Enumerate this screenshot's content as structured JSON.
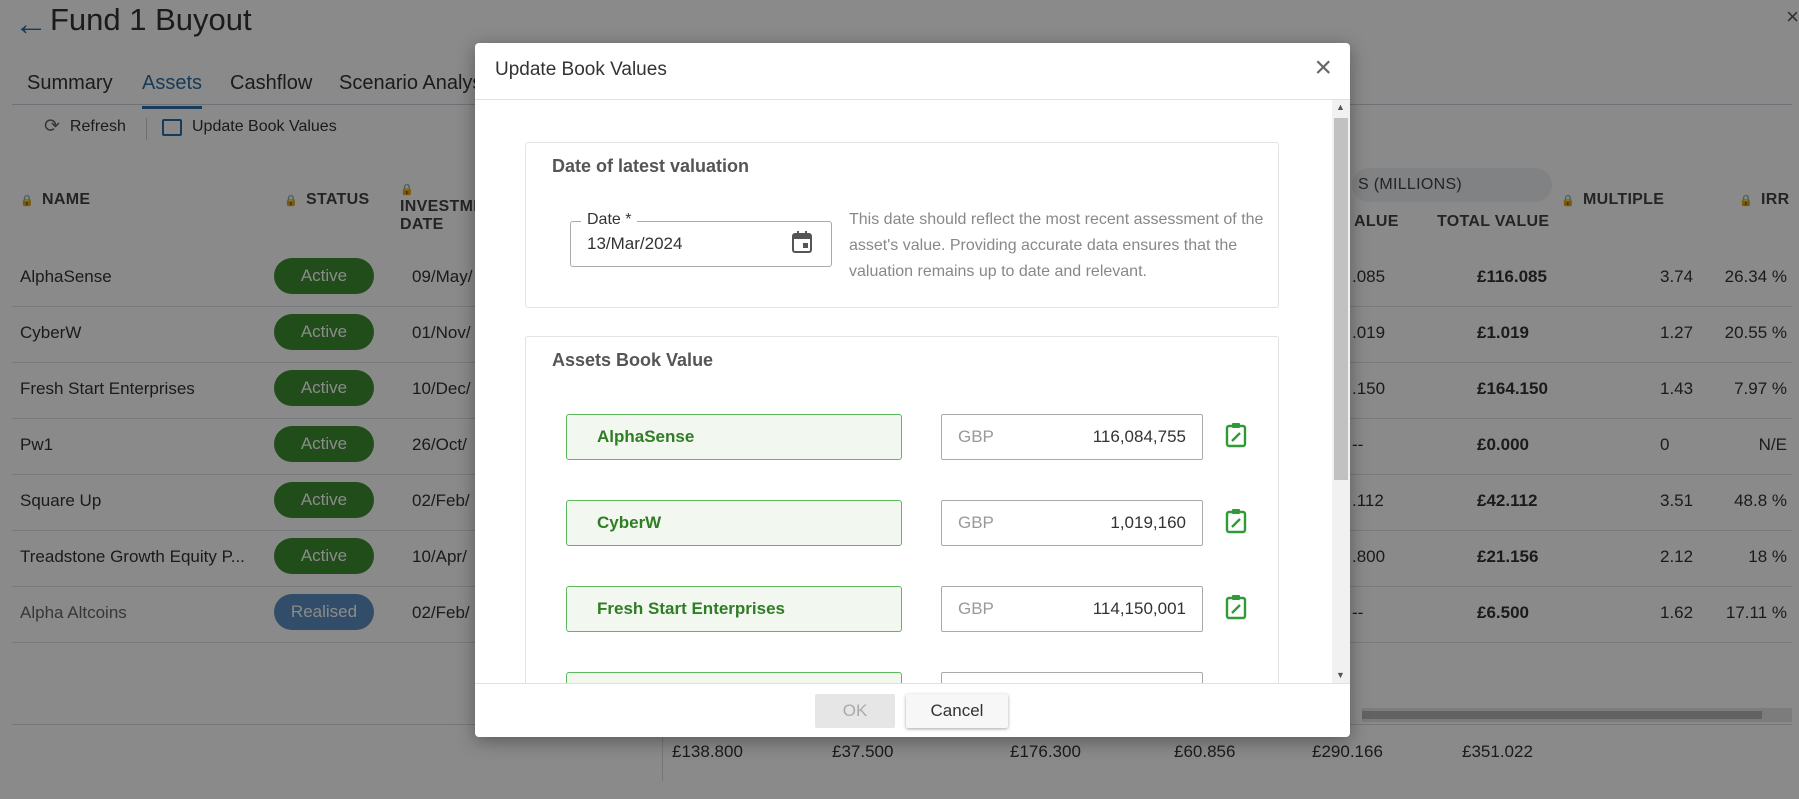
{
  "page": {
    "title": "Fund 1 Buyout",
    "tabs": [
      "Summary",
      "Assets",
      "Cashflow",
      "Scenario Analysis"
    ],
    "active_tab": "Assets",
    "toolbar": {
      "refresh": "Refresh",
      "update_book_values": "Update Book Values"
    },
    "columns": {
      "name": "NAME",
      "status": "STATUS",
      "investment_date": "INVESTMENT DATE",
      "group_header": "S (MILLIONS)",
      "alue": "ALUE",
      "total_value": "TOTAL VALUE",
      "multiple": "MULTIPLE",
      "irr": "IRR"
    },
    "rows": [
      {
        "name": "AlphaSense",
        "status": "Active",
        "date": "09/May/",
        "value": ".085",
        "total": "£116.085",
        "multiple": "3.74",
        "irr": "26.34 %"
      },
      {
        "name": "CyberW",
        "status": "Active",
        "date": "01/Nov/",
        "value": ".019",
        "total": "£1.019",
        "multiple": "1.27",
        "irr": "20.55 %"
      },
      {
        "name": "Fresh Start Enterprises",
        "status": "Active",
        "date": "10/Dec/",
        "value": ".150",
        "total": "£164.150",
        "multiple": "1.43",
        "irr": "7.97 %"
      },
      {
        "name": "Pw1",
        "status": "Active",
        "date": "26/Oct/",
        "value": "--",
        "total": "£0.000",
        "multiple": "0",
        "irr": "N/E"
      },
      {
        "name": "Square Up",
        "status": "Active",
        "date": "02/Feb/",
        "value": ".112",
        "total": "£42.112",
        "multiple": "3.51",
        "irr": "48.8 %"
      },
      {
        "name": "Treadstone Growth Equity P...",
        "status": "Active",
        "date": "10/Apr/",
        "value": ".800",
        "total": "£21.156",
        "multiple": "2.12",
        "irr": "18 %"
      },
      {
        "name": "Alpha Altcoins",
        "status": "Realised",
        "date": "02/Feb/",
        "value": "--",
        "total": "£6.500",
        "multiple": "1.62",
        "irr": "17.11 %"
      }
    ],
    "totals": [
      "£138.800",
      "£37.500",
      "£176.300",
      "£60.856",
      "£290.166",
      "£351.022"
    ]
  },
  "modal": {
    "title": "Update Book Values",
    "valuation_section": {
      "title": "Date of latest valuation",
      "date_label": "Date *",
      "date_value": "13/Mar/2024",
      "help_text": "This date should reflect the most recent assessment of the asset's value. Providing accurate data ensures that the valuation remains up to date and relevant."
    },
    "assets_section": {
      "title": "Assets Book Value",
      "assets": [
        {
          "name": "AlphaSense",
          "currency": "GBP",
          "value": "116,084,755"
        },
        {
          "name": "CyberW",
          "currency": "GBP",
          "value": "1,019,160"
        },
        {
          "name": "Fresh Start Enterprises",
          "currency": "GBP",
          "value": "114,150,001"
        }
      ]
    },
    "ok": "OK",
    "cancel": "Cancel"
  },
  "colors": {
    "active": "#3d8f30",
    "realised": "#5b8fc4",
    "accent": "#2e6da4",
    "asset_green": "#2f7d25"
  }
}
